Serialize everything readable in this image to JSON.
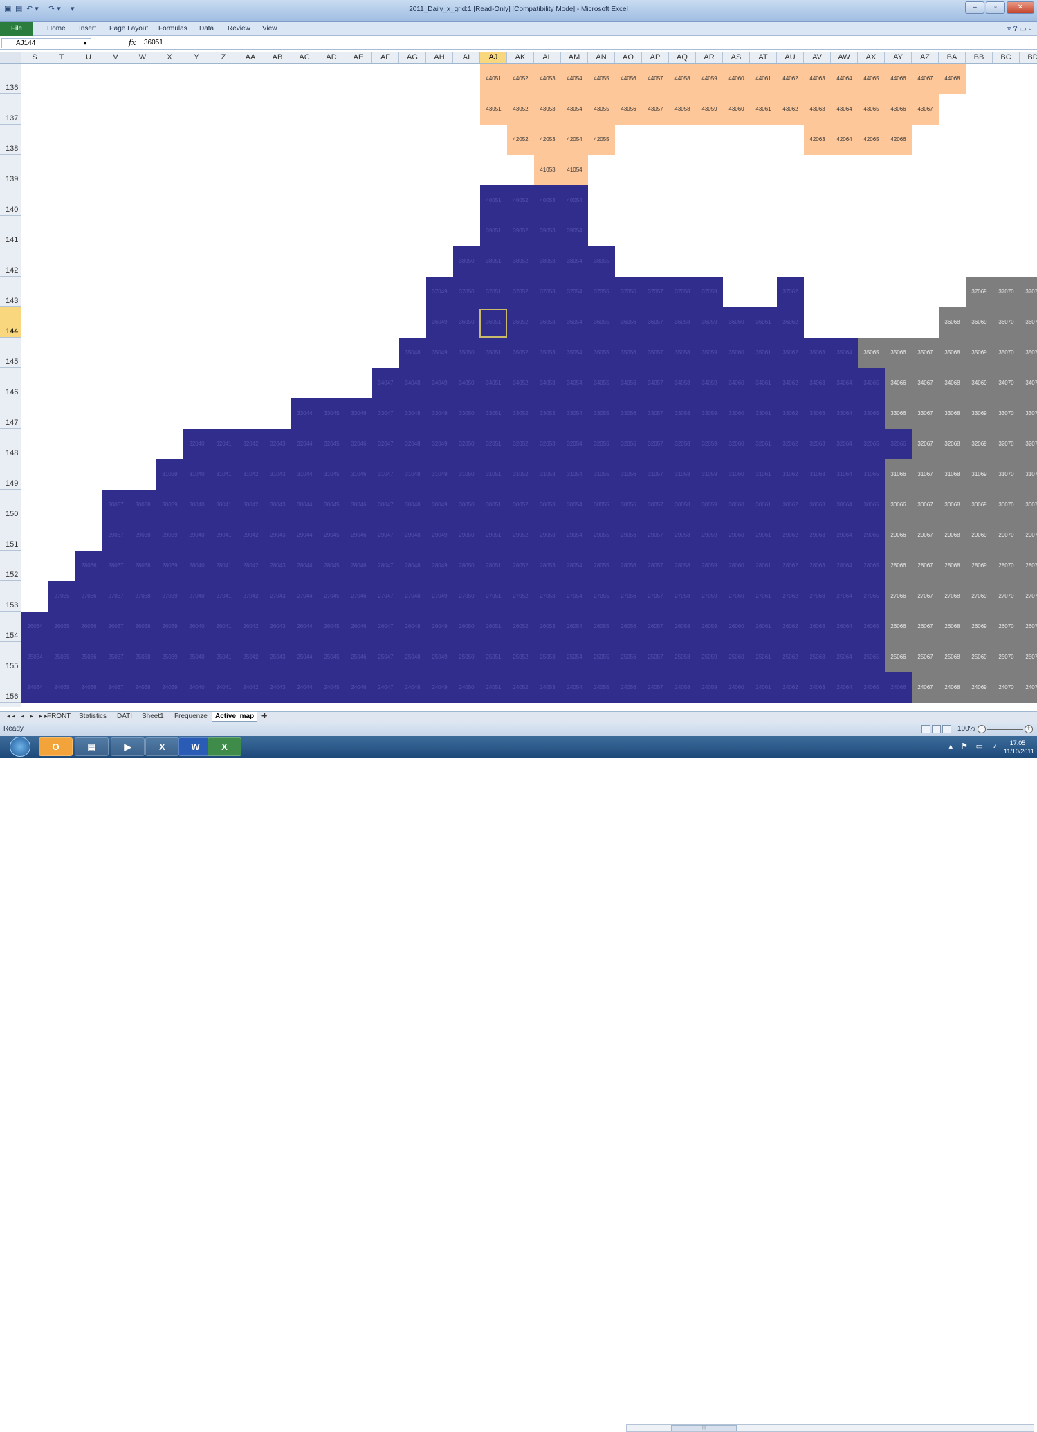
{
  "window": {
    "title": "2011_Daily_x_grid:1  [Read-Only]  [Compatibility Mode]  -  Microsoft Excel",
    "min": "–",
    "max": "▫",
    "close": "✕"
  },
  "qat": {
    "undo": "↶ ▾",
    "redo": "↷ ▾",
    "customize": "▾"
  },
  "ribbon": {
    "file": "File",
    "tabs": [
      "Home",
      "Insert",
      "Page Layout",
      "Formulas",
      "Data",
      "Review",
      "View"
    ],
    "right_icons": "▿ ? ▭ ▫"
  },
  "formula_bar": {
    "name_box": "AJ144",
    "fx": "fx",
    "value": "36051",
    "dropdown": "▾"
  },
  "columns": [
    "S",
    "T",
    "U",
    "V",
    "W",
    "X",
    "Y",
    "Z",
    "AA",
    "AB",
    "AC",
    "AD",
    "AE",
    "AF",
    "AG",
    "AH",
    "AI",
    "AJ",
    "AK",
    "AL",
    "AM",
    "AN",
    "AO",
    "AP",
    "AQ",
    "AR",
    "AS",
    "AT",
    "AU",
    "AV",
    "AW",
    "AX",
    "AY",
    "AZ",
    "BA",
    "BB",
    "BC",
    "BD"
  ],
  "selected_column": "AJ",
  "rows": [
    "136",
    "137",
    "138",
    "139",
    "140",
    "141",
    "142",
    "143",
    "144",
    "145",
    "146",
    "147",
    "148",
    "149",
    "150",
    "151",
    "152",
    "153",
    "154",
    "155",
    "156"
  ],
  "selected_row": "144",
  "cell_colors": {
    "orange": "#fdc799",
    "blue": "#302d8c",
    "gray": "#7e7e7e"
  },
  "grid": {
    "first_col_number": 34,
    "row_prefix": [
      44,
      43,
      42,
      41,
      40,
      39,
      38,
      37,
      36,
      35,
      34,
      33,
      32,
      31,
      30,
      29,
      28,
      27,
      26,
      25,
      24
    ],
    "runs": [
      [
        [
          17,
          34,
          "o"
        ]
      ],
      [
        [
          17,
          33,
          "o"
        ]
      ],
      [
        [
          18,
          21,
          "o"
        ],
        [
          29,
          32,
          "o"
        ]
      ],
      [
        [
          19,
          20,
          "o"
        ]
      ],
      [
        [
          17,
          20,
          "b"
        ]
      ],
      [
        [
          17,
          20,
          "b"
        ]
      ],
      [
        [
          16,
          21,
          "b"
        ]
      ],
      [
        [
          15,
          25,
          "b"
        ],
        [
          28,
          28,
          "b"
        ],
        [
          35,
          37,
          "g"
        ]
      ],
      [
        [
          15,
          28,
          "b"
        ],
        [
          34,
          37,
          "g"
        ]
      ],
      [
        [
          14,
          30,
          "b"
        ],
        [
          31,
          37,
          "g"
        ]
      ],
      [
        [
          13,
          31,
          "b"
        ],
        [
          32,
          37,
          "g"
        ]
      ],
      [
        [
          10,
          31,
          "b"
        ],
        [
          32,
          37,
          "g"
        ]
      ],
      [
        [
          6,
          32,
          "b"
        ],
        [
          33,
          37,
          "g"
        ]
      ],
      [
        [
          5,
          31,
          "b"
        ],
        [
          32,
          37,
          "g"
        ]
      ],
      [
        [
          3,
          31,
          "b"
        ],
        [
          32,
          37,
          "g"
        ]
      ],
      [
        [
          3,
          31,
          "b"
        ],
        [
          32,
          37,
          "g"
        ]
      ],
      [
        [
          2,
          31,
          "b"
        ],
        [
          32,
          37,
          "g"
        ]
      ],
      [
        [
          1,
          31,
          "b"
        ],
        [
          32,
          37,
          "g"
        ]
      ],
      [
        [
          0,
          31,
          "b"
        ],
        [
          32,
          37,
          "g"
        ]
      ],
      [
        [
          0,
          31,
          "b"
        ],
        [
          32,
          37,
          "g"
        ]
      ],
      [
        [
          0,
          32,
          "b"
        ],
        [
          33,
          37,
          "g"
        ]
      ]
    ],
    "active_cell": {
      "row": 8,
      "col": 17
    }
  },
  "sheet_tabs": [
    "FRONT",
    "Statistics",
    "DATI",
    "Sheet1",
    "Frequenze",
    "Active_map"
  ],
  "active_sheet": "Active_map",
  "tab_nav": "◂◂ ◂ ▸ ▸▸",
  "status": {
    "ready": "Ready",
    "zoom": "100%"
  },
  "taskbar": {
    "apps": [
      "O",
      "▤",
      "▶",
      "X",
      "W",
      "X"
    ],
    "time": "17:05",
    "date": "11/10/2011"
  }
}
